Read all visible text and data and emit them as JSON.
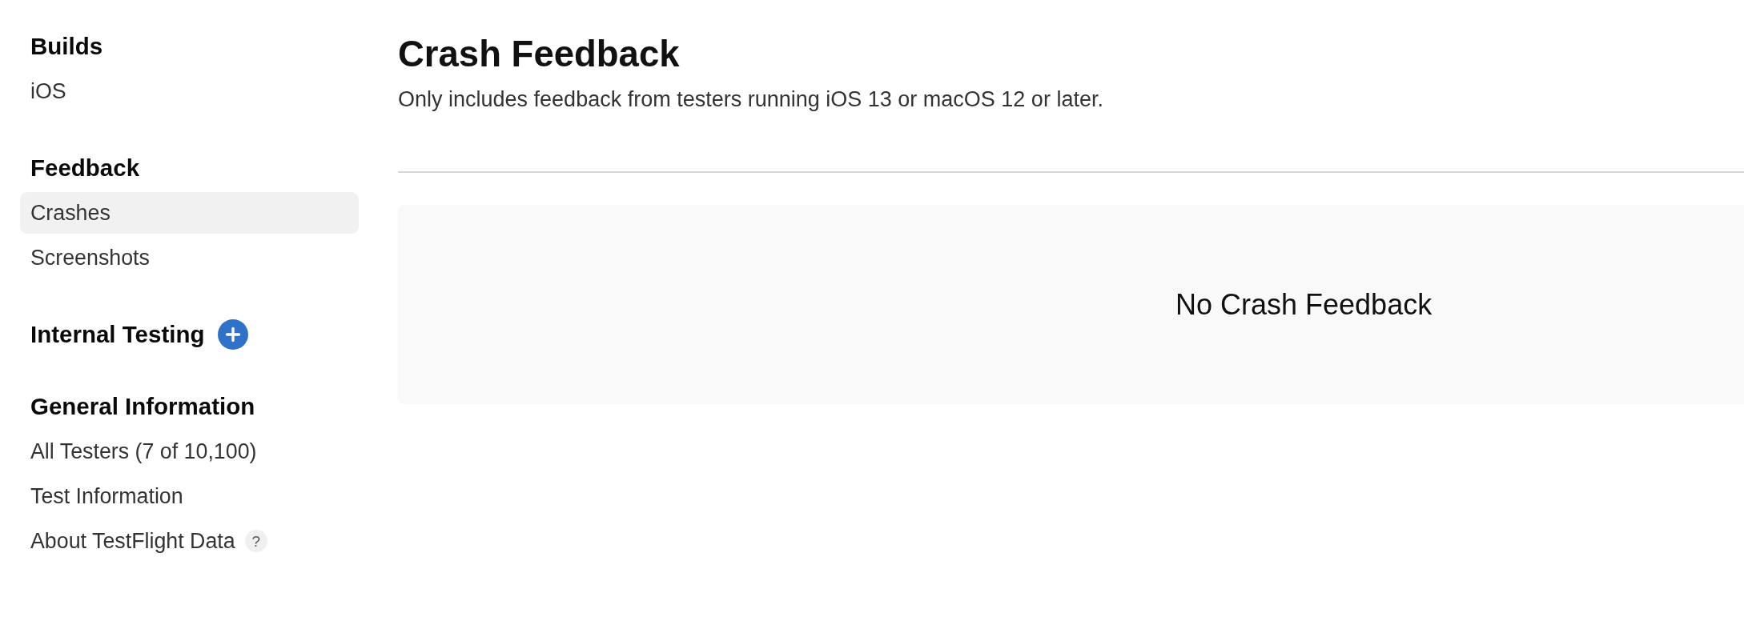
{
  "sidebar": {
    "sections": [
      {
        "title": "Builds",
        "items": [
          {
            "label": "iOS",
            "selected": false
          }
        ]
      },
      {
        "title": "Feedback",
        "items": [
          {
            "label": "Crashes",
            "selected": true
          },
          {
            "label": "Screenshots",
            "selected": false
          }
        ]
      },
      {
        "title": "Internal Testing",
        "add_button": true
      },
      {
        "title": "General Information",
        "items": [
          {
            "label": "All Testers (7 of 10,100)",
            "selected": false
          },
          {
            "label": "Test Information",
            "selected": false
          },
          {
            "label": "About TestFlight Data",
            "selected": false,
            "help": "?"
          }
        ]
      }
    ]
  },
  "page": {
    "title": "Crash Feedback",
    "subtitle": "Only includes feedback from testers running iOS 13 or macOS 12 or later."
  },
  "empty_state": {
    "message": "No Crash Feedback"
  }
}
